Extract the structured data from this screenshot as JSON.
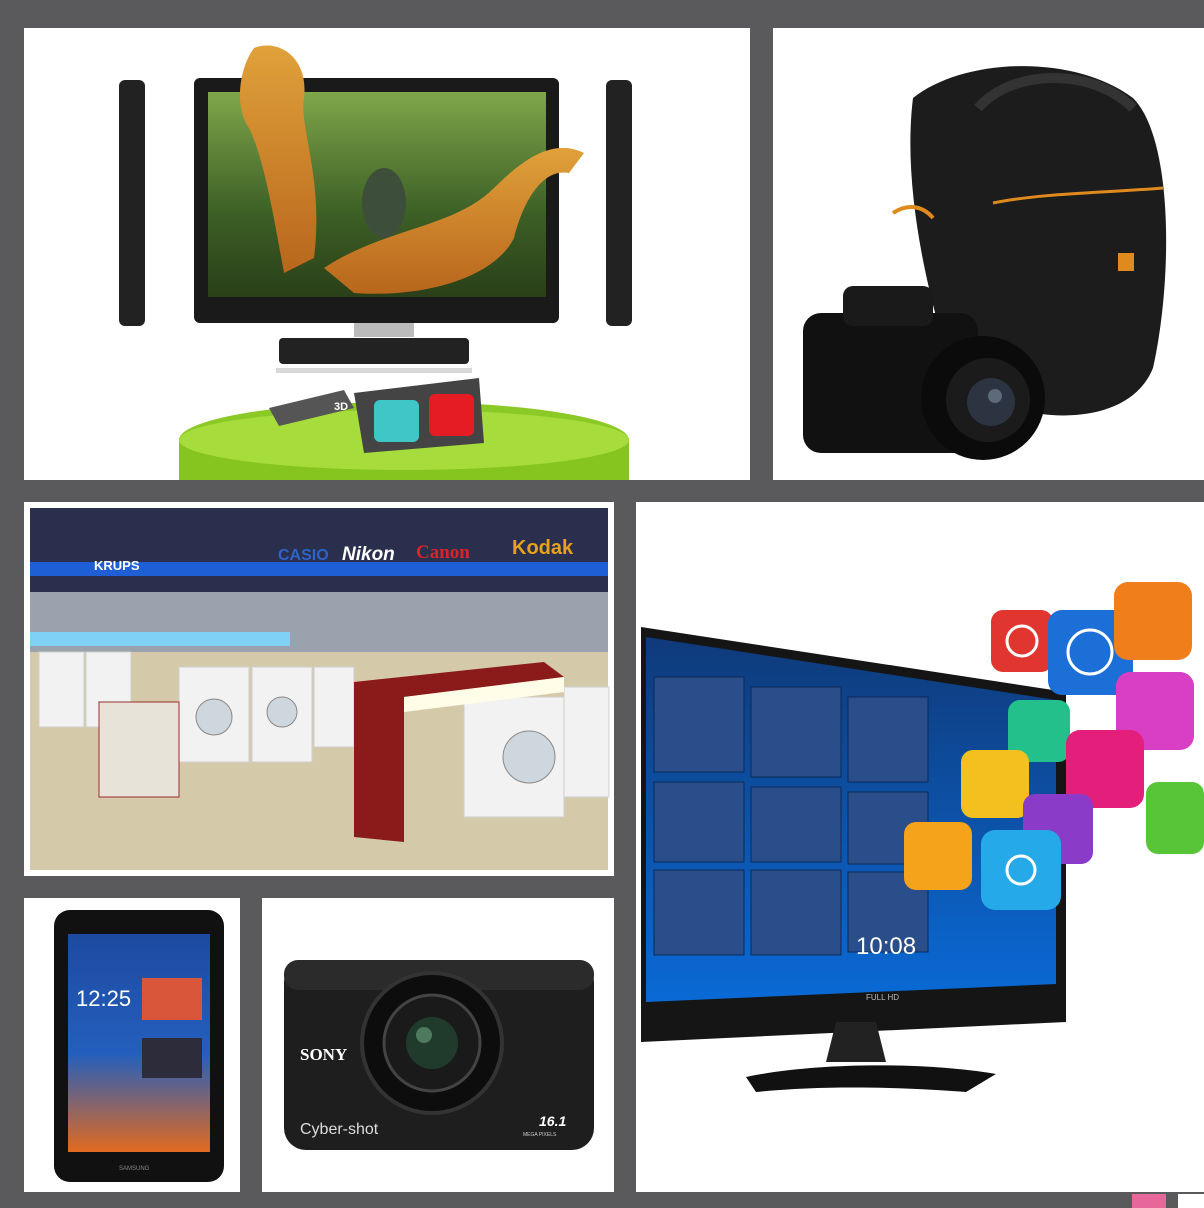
{
  "panels": {
    "tv3d": {
      "glasses_label": "3D"
    },
    "electronics_store": {
      "brands": [
        "CASIO",
        "Nikon",
        "Canon",
        "Kodak"
      ],
      "left_sign": "KRUPS"
    },
    "smart_tv": {
      "clock": "10:08",
      "brand": "FULL HD"
    },
    "tablet": {
      "time": "12:25",
      "brand": "SAMSUNG"
    },
    "sony_camera": {
      "brand": "SONY",
      "model": "Cyber-shot",
      "megapixels": "16.1",
      "mp_label": "MEGA PIXELS"
    }
  },
  "colors": {
    "background": "#5a5a5c",
    "accent_pink": "#e8679a"
  }
}
